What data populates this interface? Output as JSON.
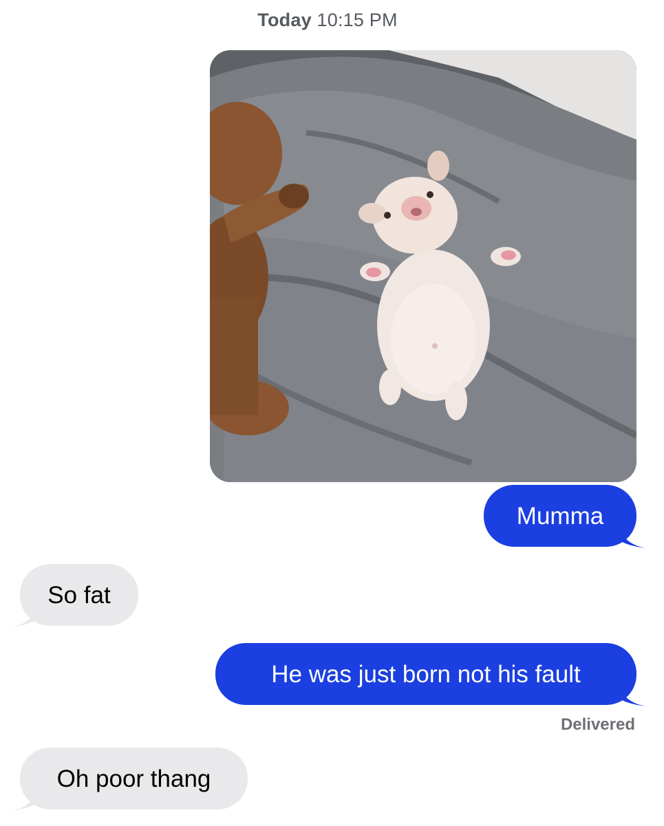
{
  "thread": {
    "timestamp_day": "Today",
    "timestamp_time": "10:15 PM",
    "delivered_label": "Delivered"
  },
  "attachment": {
    "icon": "photo-icon"
  },
  "messages": [
    {
      "from": "me",
      "text": "Mumma"
    },
    {
      "from": "them",
      "text": "So fat"
    },
    {
      "from": "me",
      "text": "He was just born not his fault"
    },
    {
      "from": "them",
      "text": "Oh poor thang"
    }
  ],
  "colors": {
    "sent_bubble": "#1b3fe0",
    "received_bubble": "#e9e9eb",
    "timestamp_text": "#555a60"
  }
}
